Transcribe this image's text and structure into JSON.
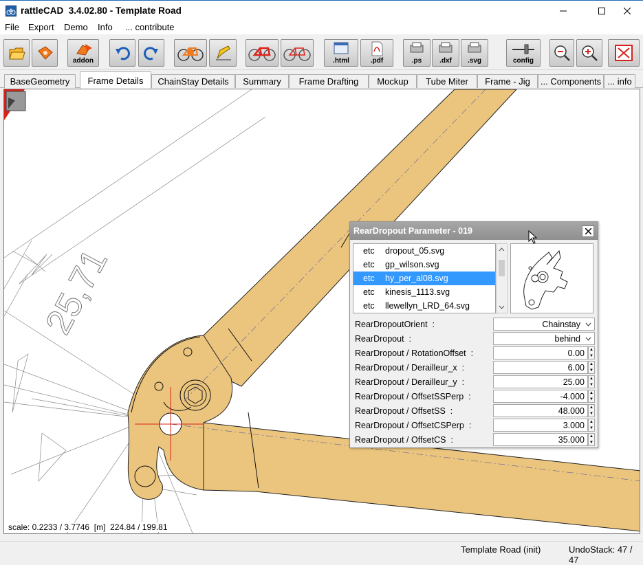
{
  "window": {
    "title": "rattleCAD  3.4.02.80 - Template Road",
    "app_icon": "rattlecad-app-icon",
    "controls": [
      "minimize",
      "maximize",
      "close"
    ]
  },
  "menu": [
    "File",
    "Export",
    "Demo",
    "Info",
    "... contribute"
  ],
  "toolbar": {
    "addon_label": "addon",
    "html_label": ".html",
    "pdf_label": ".pdf",
    "ps_label": ".ps",
    "dxf_label": ".dxf",
    "svg_label": ".svg",
    "config_label": "config",
    "icons": [
      "open-folder-icon",
      "save-disk-icon",
      "addon-icon",
      "undo-icon",
      "redo-icon",
      "render-bike-icon",
      "pencil-icon",
      "bike-red-icon",
      "bike-red-outline-icon",
      "export-html-icon",
      "export-pdf-icon",
      "export-ps-icon",
      "export-dxf-icon",
      "export-svg-icon",
      "config-icon",
      "zoom-out-icon",
      "zoom-in-icon",
      "fit-screen-icon"
    ]
  },
  "tabs": [
    "BaseGeometry",
    "Frame Details",
    "ChainStay Details",
    "Summary",
    "Frame Drafting",
    "Mockup",
    "Tube Miter",
    "Frame - Jig",
    "... Components",
    "... info"
  ],
  "active_tab": "Frame Details",
  "canvas": {
    "scale_readout": "scale: 0.2233 / 3.7746  [m]  224.84 / 199.81",
    "dimension_text": "25,71",
    "frame_color": "#ebc57d"
  },
  "panel": {
    "title": "RearDropout Parameter - 019",
    "files": [
      {
        "dir": "etc",
        "name": "dropout_05.svg"
      },
      {
        "dir": "etc",
        "name": "gp_wilson.svg"
      },
      {
        "dir": "etc",
        "name": "hy_per_al08.svg"
      },
      {
        "dir": "etc",
        "name": "kinesis_1113.svg"
      },
      {
        "dir": "etc",
        "name": "llewellyn_LRD_64.svg"
      }
    ],
    "selected_file": "hy_per_al08.svg",
    "params": [
      {
        "label": "RearDropoutOrient  :",
        "value": "Chainstay"
      },
      {
        "label": "RearDropout  :",
        "value": "behind"
      },
      {
        "label": "RearDropout / RotationOffset  :",
        "value": "0.00"
      },
      {
        "label": "RearDropout / Derailleur_x  :",
        "value": "6.00"
      },
      {
        "label": "RearDropout / Derailleur_y  :",
        "value": "25.00"
      },
      {
        "label": "RearDropout / OffsetSSPerp  :",
        "value": "-4.000"
      },
      {
        "label": "RearDropout / OffsetSS  :",
        "value": "48.000"
      },
      {
        "label": "RearDropout / OffsetCSPerp  :",
        "value": "3.000"
      },
      {
        "label": "RearDropout / OffsetCS  :",
        "value": "35.000"
      }
    ]
  },
  "status": {
    "center": "Template Road (init)",
    "right": "UndoStack: 47 / 47"
  },
  "colors": {
    "selection": "#3399ff",
    "panel_title_bg": "#999999",
    "frame_fill": "#ebc57d",
    "accent_red": "#e0221b"
  }
}
